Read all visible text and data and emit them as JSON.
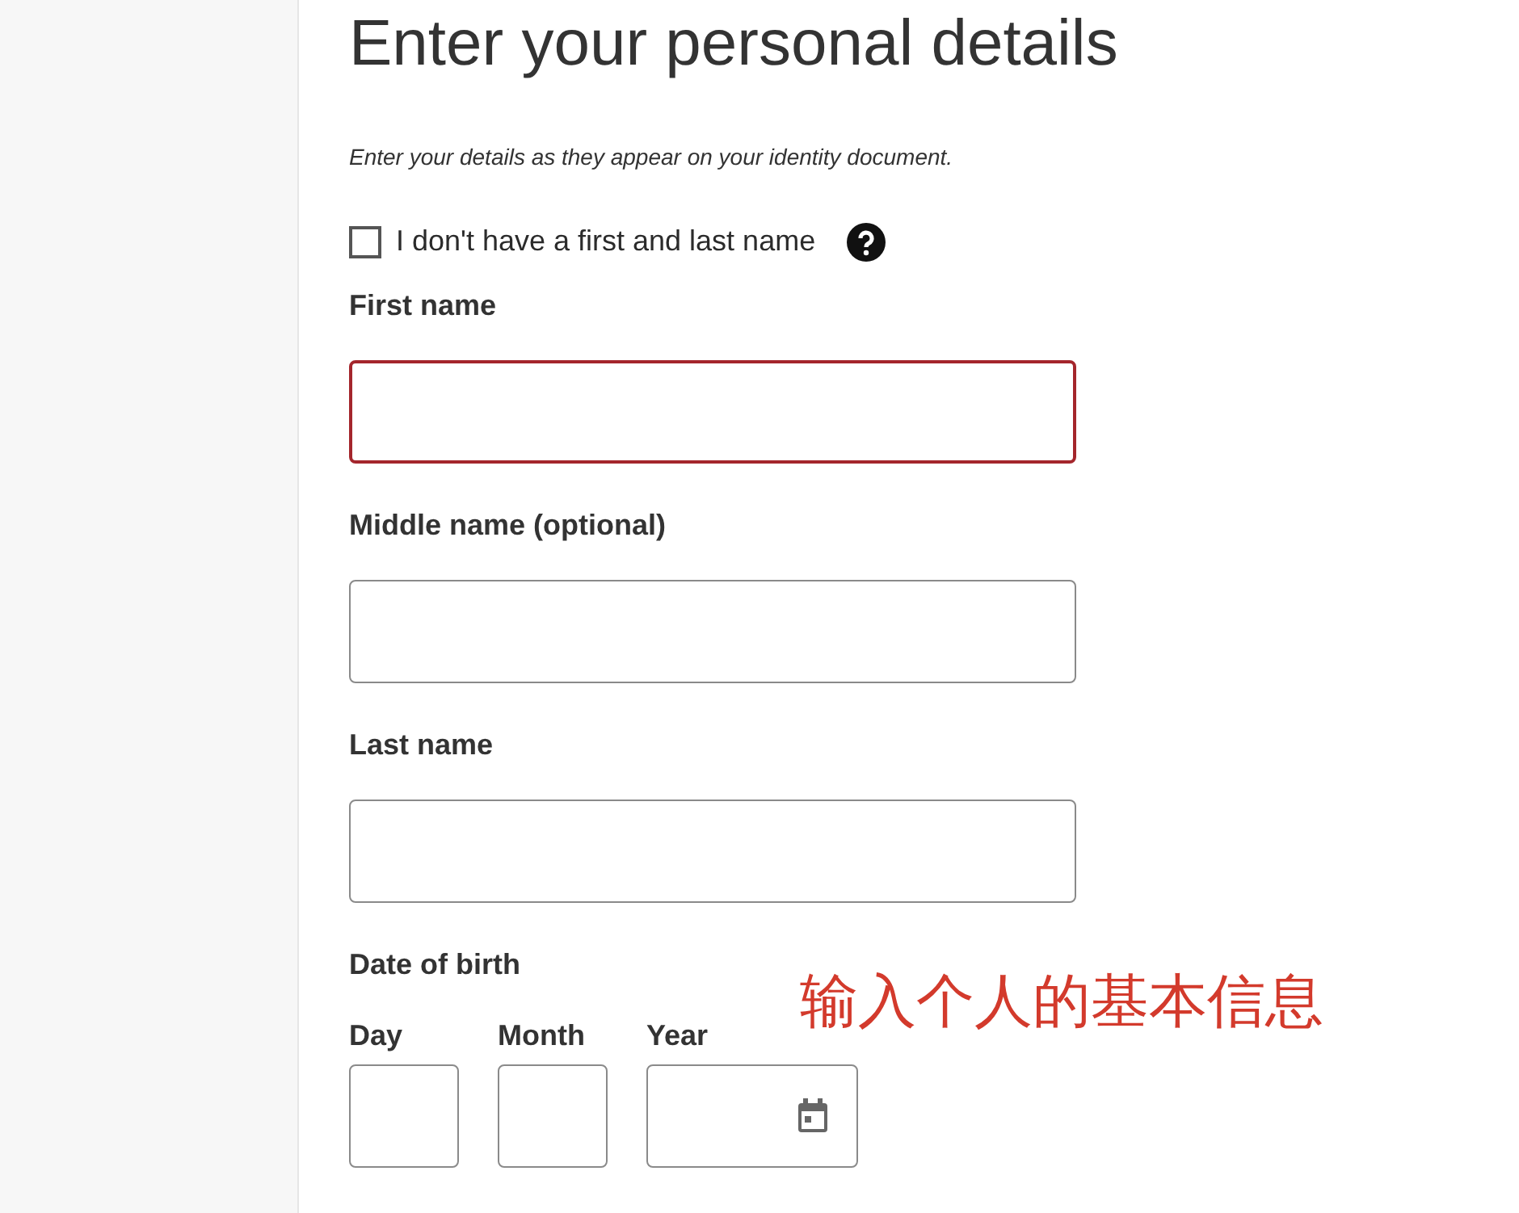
{
  "title": "Enter your personal details",
  "subtitle": "Enter your details as they appear on your identity document.",
  "no_name_checkbox": {
    "label": "I don't have a first and last name",
    "checked": false
  },
  "fields": [
    {
      "label": "First name",
      "error": true
    },
    {
      "label": "Middle name (optional)",
      "error": false
    },
    {
      "label": "Last name",
      "error": false
    }
  ],
  "date_of_birth": {
    "label": "Date of birth",
    "parts": [
      {
        "label": "Day",
        "kind": "text"
      },
      {
        "label": "Month",
        "kind": "text"
      },
      {
        "label": "Year",
        "kind": "calendar"
      }
    ]
  },
  "annotation": "输入个人的基本信息"
}
